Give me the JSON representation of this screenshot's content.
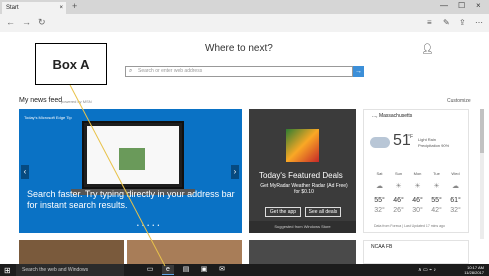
{
  "browser": {
    "tab_title": "Start",
    "tab_close": "×",
    "new_tab": "+",
    "controls": [
      "—",
      "☐",
      "×"
    ],
    "nav": [
      "←",
      "→",
      "↻"
    ],
    "tools": [
      "≡",
      "✎",
      "⇪",
      "⋯"
    ]
  },
  "start_page": {
    "heading": "Where to next?",
    "search_placeholder": "Search or enter web address",
    "search_go": "→",
    "feed_label": "My news feed",
    "powered_by": "powered by MSN",
    "customize": "Customize"
  },
  "hero": {
    "tag": "Today's Microsoft Edge Tip",
    "text": "Search faster. Try typing directly in your address bar for instant search results.",
    "prev": "‹",
    "next": "›",
    "dots": "• • • • •"
  },
  "featured": {
    "title": "Today's Featured Deals",
    "description": "Get MyRadar Weather Radar (Ad Free) for $0.10",
    "btn_app": "Get the app",
    "btn_deals": "See all deals",
    "footer": "Suggested from Windows Store"
  },
  "weather": {
    "location": "..., Massachusetts",
    "temp": "51",
    "unit": "°F",
    "condition": "Light Rain",
    "precip": "Precipitation 90%",
    "days": [
      {
        "name": "Sat",
        "icon": "☁",
        "hi": "55°",
        "lo": "32°"
      },
      {
        "name": "Sun",
        "icon": "☀",
        "hi": "46°",
        "lo": "26°"
      },
      {
        "name": "Mon",
        "icon": "☀",
        "hi": "46°",
        "lo": "30°"
      },
      {
        "name": "Tue",
        "icon": "☀",
        "hi": "55°",
        "lo": "42°"
      },
      {
        "name": "Wed",
        "icon": "☁",
        "hi": "61°",
        "lo": "32°"
      }
    ],
    "footer": "Data from Foreca | Last Updated 17 mins ago"
  },
  "bottom": {
    "ncaa": "NCAA FB"
  },
  "taskbar": {
    "search": "Search the web and Windows",
    "time": "10:17 AM",
    "date": "11/28/2017"
  },
  "annotation": {
    "label": "Box A"
  }
}
